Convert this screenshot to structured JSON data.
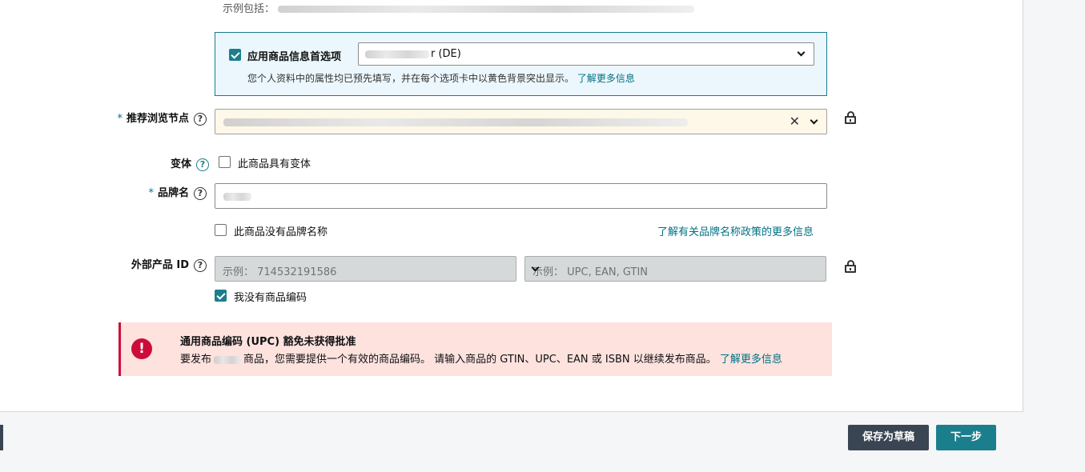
{
  "example_line": {
    "prefix": "示例包括："
  },
  "product_preference": {
    "label": "应用商品信息首选项",
    "checked": true,
    "selected_value_suffix": "r (DE)",
    "description": "您个人资料中的属性均已预先填写，并在每个选项卡中以黄色背景突出显示。",
    "learn_more": "了解更多信息"
  },
  "browse_node": {
    "label": "推荐浏览节点",
    "required": "*"
  },
  "variation": {
    "label": "变体",
    "checkbox_label": "此商品具有变体",
    "checked": false
  },
  "brand": {
    "label": "品牌名",
    "required": "*",
    "no_brand_label": "此商品没有品牌名称",
    "no_brand_checked": false,
    "policy_link": "了解有关品牌名称政策的更多信息"
  },
  "external_id": {
    "label": "外部产品 ID",
    "input_placeholder": "示例： 714532191586",
    "type_placeholder": "示例： UPC, EAN, GTIN",
    "no_code_label": "我没有商品编码",
    "no_code_checked": true
  },
  "alert": {
    "title": "通用商品编码 (UPC) 豁免未获得批准",
    "desc_prefix": "要发布",
    "desc_suffix": "商品，您需要提供一个有效的商品编码。 请输入商品的 GTIN、UPC、EAN 或 ISBN 以继续发布商品。",
    "learn_more": "了解更多信息"
  },
  "footer": {
    "save_draft": "保存为草稿",
    "next": "下一步"
  },
  "colors": {
    "accent": "#1b7e8c",
    "alert_bg": "#fde2de",
    "alert_red": "#cc0c39",
    "highlight_yellow": "#fef8e8"
  }
}
